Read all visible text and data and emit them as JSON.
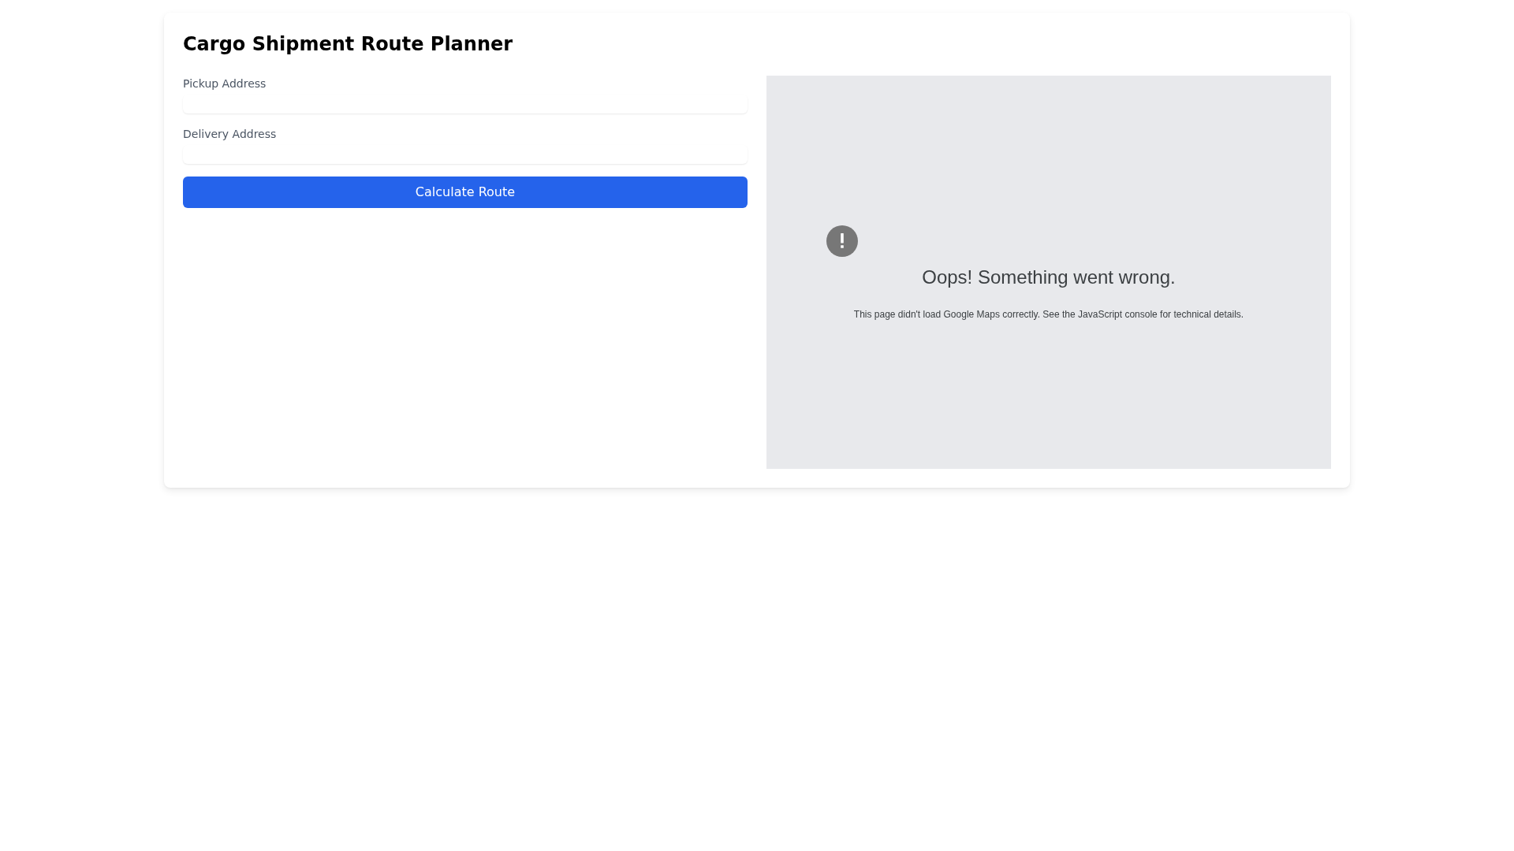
{
  "title": "Cargo Shipment Route Planner",
  "form": {
    "fields": [
      {
        "label": "Pickup Address"
      },
      {
        "label": "Delivery Address"
      }
    ],
    "button": "Calculate Route"
  },
  "map": {
    "error": {
      "heading": "Oops! Something went wrong.",
      "message": "This page didn't load Google Maps correctly. See the JavaScript console for technical details."
    }
  }
}
